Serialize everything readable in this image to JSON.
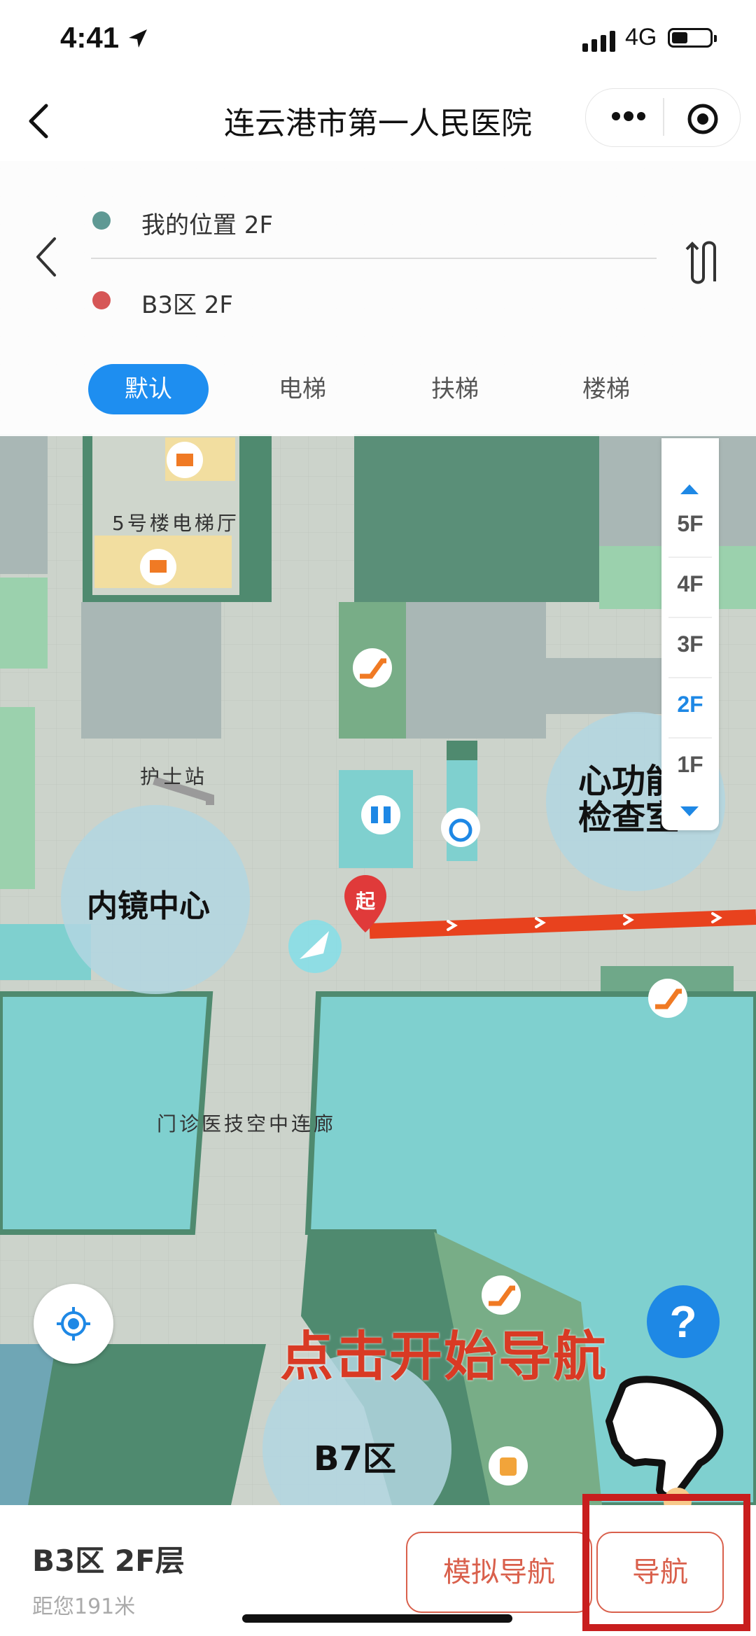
{
  "status_bar": {
    "time": "4:41",
    "network": "4G"
  },
  "navbar": {
    "title": "连云港市第一人民医院"
  },
  "route": {
    "start": "我的位置 2F",
    "end": "B3区 2F",
    "modes": [
      "默认",
      "电梯",
      "扶梯",
      "楼梯"
    ],
    "selected_mode": "默认"
  },
  "floors": {
    "items": [
      "5F",
      "4F",
      "3F",
      "2F",
      "1F"
    ],
    "current": "2F"
  },
  "map": {
    "labels": {
      "elevator_hall": "5号楼电梯厅",
      "nurse_station": "护士站",
      "endoscopy_center": "内镜中心",
      "cardiac_exam": "心功能\n检查室",
      "corridor": "门诊医技空中连廊",
      "zone_b7": "B7区",
      "start_marker": "起"
    },
    "colors": {
      "route": "#e8421e",
      "accent": "#1e8ef0",
      "floor_grey": "#c8d0c8"
    }
  },
  "annotation": "点击开始导航",
  "help_label": "?",
  "destination": {
    "name": "B3区 2F层",
    "distance": "距您191米"
  },
  "buttons": {
    "simulate": "模拟导航",
    "navigate": "导航"
  }
}
